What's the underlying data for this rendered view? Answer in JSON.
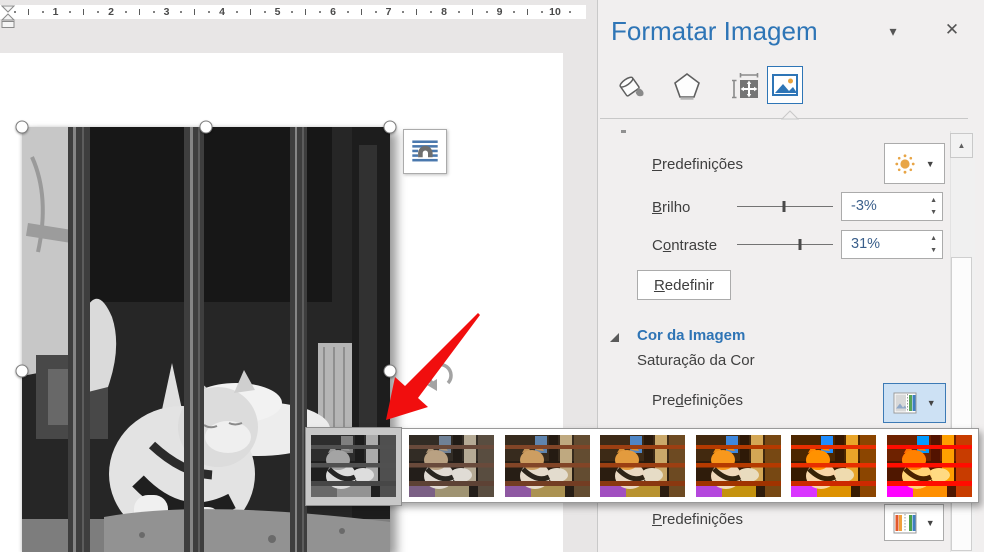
{
  "ruler": {
    "numbers": [
      "1",
      "2",
      "3",
      "4",
      "5",
      "6",
      "7",
      "8",
      "9",
      "10"
    ]
  },
  "panel": {
    "title": "Formatar Imagem",
    "window_controls": {
      "collapse_icon": "chevron-down",
      "close_icon": "close",
      "collapse_glyph": "▾",
      "close_glyph": "✕"
    },
    "tabs": [
      {
        "icon": "fill-line-icon",
        "selected": false
      },
      {
        "icon": "effects-icon",
        "selected": false
      },
      {
        "icon": "layout-properties-icon",
        "selected": false
      },
      {
        "icon": "picture-icon",
        "selected": true
      }
    ],
    "corrections": {
      "presets_label": {
        "text": "Predefinições",
        "accel": 0
      },
      "brightness": {
        "label": {
          "text": "Brilho",
          "accel": 0
        },
        "value": "-3%",
        "value_num": -3
      },
      "contrast": {
        "label": {
          "text": "Contraste",
          "accel": 1
        },
        "value": "31%",
        "value_num": 31
      },
      "reset_button": {
        "text": "Redefinir",
        "accel": 0
      }
    },
    "picture_color": {
      "header": "Cor da Imagem",
      "saturation_label": "Saturação da Cor",
      "presets_label": {
        "text": "Predefinições",
        "accel": 3
      },
      "tone_presets_label": {
        "text": "Predefinições",
        "accel": 0
      }
    },
    "scrollbar": {
      "up_glyph": "▲"
    }
  },
  "gallery": {
    "items": [
      {
        "name": "saturation-0",
        "saturation_percent": 0,
        "selected": true
      },
      {
        "name": "saturation-33",
        "saturation_percent": 33,
        "selected": false
      },
      {
        "name": "saturation-66",
        "saturation_percent": 66,
        "selected": false
      },
      {
        "name": "saturation-100",
        "saturation_percent": 100,
        "selected": false
      },
      {
        "name": "saturation-133",
        "saturation_percent": 133,
        "selected": false
      },
      {
        "name": "saturation-200",
        "saturation_percent": 200,
        "selected": false
      },
      {
        "name": "saturation-400",
        "saturation_percent": 400,
        "selected": false
      }
    ]
  },
  "annotation": {
    "arrow_color": "#f10e0e"
  },
  "colors": {
    "accent_blue": "#2e75b6",
    "panel_bg": "#f1efef",
    "canvas_bg": "#e8e6e6",
    "value_text": "#3a5f8b"
  }
}
